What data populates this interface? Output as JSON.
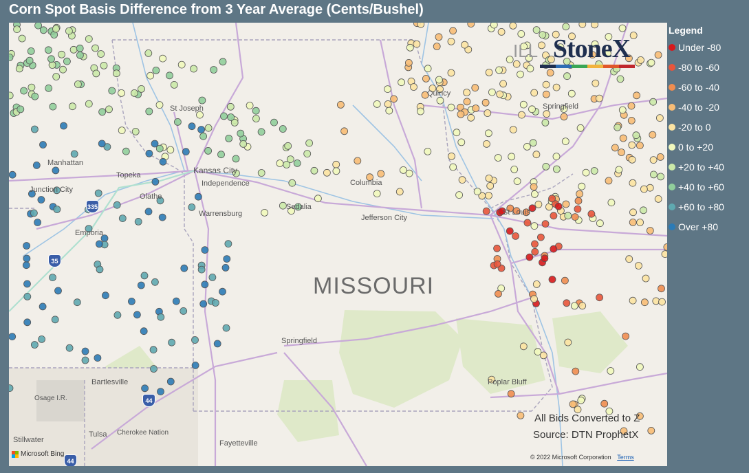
{
  "title": "Corn Spot Basis Difference from 3 Year Average (Cents/Bushel)",
  "legend": {
    "title": "Legend",
    "items": [
      {
        "label": "Under -80",
        "color": "#d7191c"
      },
      {
        "label": "-80 to -60",
        "color": "#e8553b"
      },
      {
        "label": "-60 to -40",
        "color": "#f08d50"
      },
      {
        "label": "-40 to -20",
        "color": "#f8bc76"
      },
      {
        "label": "-20 to 0",
        "color": "#fce3a2"
      },
      {
        "label": "0 to +20",
        "color": "#f1f8bd"
      },
      {
        "label": "+20 to +40",
        "color": "#cbe9a8"
      },
      {
        "label": "+40 to +60",
        "color": "#91ce9b"
      },
      {
        "label": "+60 to +80",
        "color": "#5fa9b0"
      },
      {
        "label": "Over +80",
        "color": "#2c7bb6"
      }
    ]
  },
  "logo": {
    "text": "StoneX",
    "bar_colors": [
      "#1f2f4f",
      "#2e6db4",
      "#3aa655",
      "#f2b33d",
      "#e0572a",
      "#c0272d"
    ]
  },
  "map": {
    "state_label": "MISSOURI",
    "cities": [
      "St Joseph",
      "Manhattan",
      "Topeka",
      "Kansas City",
      "Independence",
      "Junction City",
      "Olathe",
      "Columbia",
      "Sedalia",
      "Warrensburg",
      "Jefferson City",
      "Emporia",
      "St Louis",
      "Quincy",
      "Springfield",
      "Springfield",
      "Bartlesville",
      "Osage I.R.",
      "Tulsa",
      "Cherokee Nation",
      "Stillwater",
      "Fayetteville",
      "Poplar Bluff"
    ],
    "highways": [
      "335",
      "35",
      "44",
      "44",
      "44"
    ],
    "state_prefix": "ILL"
  },
  "notes": {
    "line1": "All Bids Converted to Z",
    "line2": "Source: DTN ProphetX"
  },
  "attribution": {
    "bing": "Microsoft Bing",
    "copyright": "© 2022 Microsoft Corporation",
    "terms": "Terms"
  }
}
